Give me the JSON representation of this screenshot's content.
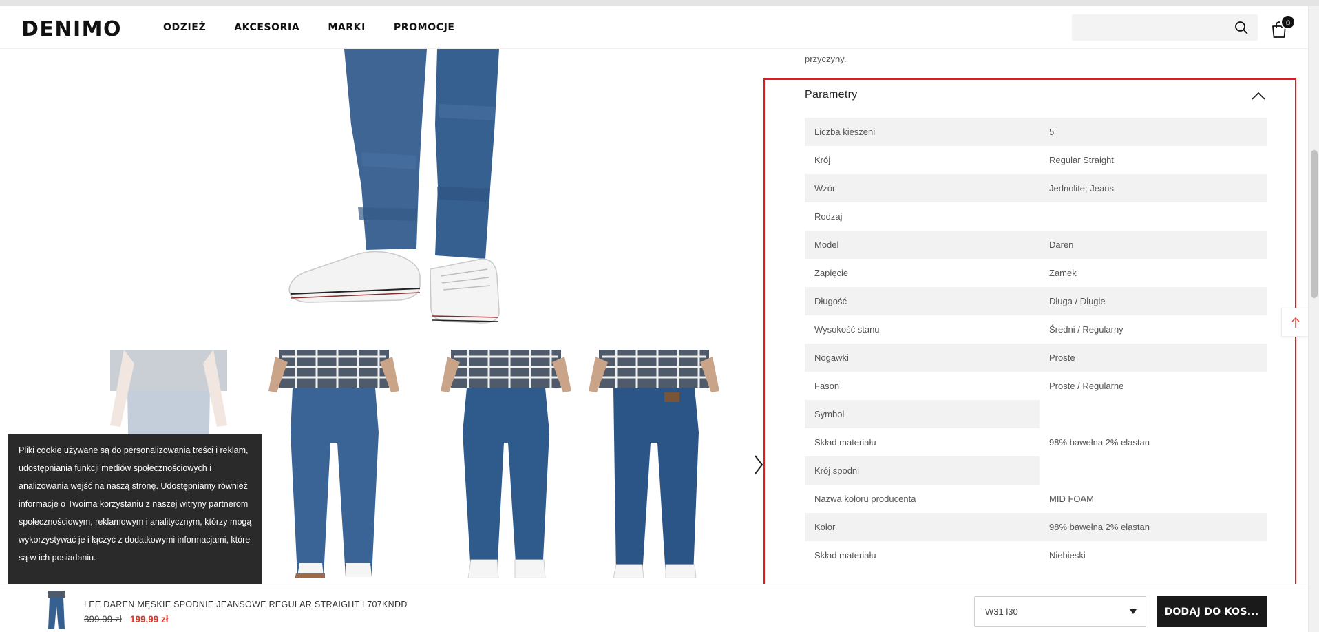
{
  "header": {
    "logo": "DENIMO",
    "nav": [
      "ODZIEŻ",
      "AKCESORIA",
      "MARKI",
      "PROMOCJE"
    ],
    "search_placeholder": "",
    "cart_count": "0"
  },
  "description_fragment": "przyczyny.",
  "parameters": {
    "title": "Parametry",
    "rows": [
      {
        "label": "Liczba kieszeni",
        "value": "5"
      },
      {
        "label": "Krój",
        "value": "Regular Straight"
      },
      {
        "label": "Wzór",
        "value": "Jednolite; Jeans"
      },
      {
        "label": "Rodzaj",
        "value": ""
      },
      {
        "label": "Model",
        "value": "Daren"
      },
      {
        "label": "Zapięcie",
        "value": "Zamek"
      },
      {
        "label": "Długość",
        "value": "Długa / Długie"
      },
      {
        "label": "Wysokość stanu",
        "value": "Średni / Regularny"
      },
      {
        "label": "Nogawki",
        "value": "Proste"
      },
      {
        "label": "Fason",
        "value": "Proste / Regularne"
      },
      {
        "label": "Symbol",
        "value": ""
      },
      {
        "label": "Skład materiału",
        "value": "98% bawełna 2% elastan"
      },
      {
        "label": "Krój spodni",
        "value": ""
      },
      {
        "label": "Nazwa koloru producenta",
        "value": "MID FOAM"
      },
      {
        "label": "Kolor",
        "value": "98% bawełna 2% elastan"
      },
      {
        "label": "Skład materiału",
        "value": "Niebieski"
      }
    ]
  },
  "cookie_text": "Pliki cookie używane są do personalizowania treści i reklam, udostępniania funkcji mediów społecznościowych i analizowania wejść na naszą stronę. Udostępniamy również informacje o Twoima korzystaniu z naszej witryny partnerom społecznościowym, reklamowym i analitycznym, którzy mogą wykorzystywać je i łączyć z dodatkowymi informacjami, które są w ich posiadaniu.",
  "sticky": {
    "product_name": "LEE DAREN MĘSKIE SPODNIE JEANSOWE REGULAR STRAIGHT L707KNDD",
    "old_price": "399,99 zł",
    "new_price": "199,99 zł",
    "size_selected": "W31 l30",
    "add_to_cart": "DODAJ DO KOS..."
  },
  "colors": {
    "accent_red": "#e11b22",
    "price_red": "#e2372a",
    "denim": "#3b5f8f",
    "dark": "#1a1a1a"
  }
}
